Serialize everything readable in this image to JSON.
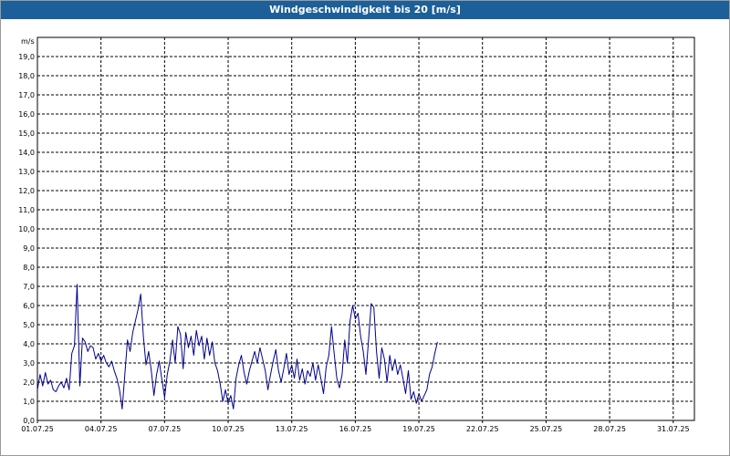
{
  "window": {
    "title": "Windgeschwindigkeit bis 20 [m/s]"
  },
  "colors": {
    "titlebar": "#1c5f99",
    "series": "#00008b",
    "grid": "#000000"
  },
  "chart_data": {
    "type": "line",
    "title": "Windgeschwindigkeit bis 20 [m/s]",
    "ylabel": "m/s",
    "xlabel": "",
    "ylim": [
      0,
      20
    ],
    "xlim": [
      "01.07.25",
      "01.08.25"
    ],
    "grid": true,
    "y_ticks": [
      "0,0",
      "1,0",
      "2,0",
      "3,0",
      "4,0",
      "5,0",
      "6,0",
      "7,0",
      "8,0",
      "9,0",
      "10,0",
      "11,0",
      "12,0",
      "13,0",
      "14,0",
      "15,0",
      "16,0",
      "17,0",
      "18,0",
      "19,0"
    ],
    "x_ticks": [
      "01.07.25",
      "04.07.25",
      "07.07.25",
      "10.07.25",
      "13.07.25",
      "16.07.25",
      "19.07.25",
      "22.07.25",
      "25.07.25",
      "28.07.25",
      "31.07.25"
    ],
    "series": [
      {
        "values": [
          {
            "x": "01.07.25 00:00",
            "y": 1.6
          },
          {
            "x": "01.07.25 03:00",
            "y": 2.4
          },
          {
            "x": "01.07.25 06:00",
            "y": 1.8
          },
          {
            "x": "01.07.25 09:00",
            "y": 2.5
          },
          {
            "x": "01.07.25 12:00",
            "y": 1.9
          },
          {
            "x": "01.07.25 15:00",
            "y": 2.1
          },
          {
            "x": "01.07.25 18:00",
            "y": 1.6
          },
          {
            "x": "01.07.25 21:00",
            "y": 1.5
          },
          {
            "x": "02.07.25 00:00",
            "y": 1.8
          },
          {
            "x": "02.07.25 03:00",
            "y": 2.0
          },
          {
            "x": "02.07.25 06:00",
            "y": 1.7
          },
          {
            "x": "02.07.25 09:00",
            "y": 2.2
          },
          {
            "x": "02.07.25 12:00",
            "y": 1.6
          },
          {
            "x": "02.07.25 15:00",
            "y": 3.5
          },
          {
            "x": "02.07.25 18:00",
            "y": 3.9
          },
          {
            "x": "02.07.25 21:00",
            "y": 7.1
          },
          {
            "x": "03.07.25 00:00",
            "y": 1.8
          },
          {
            "x": "03.07.25 03:00",
            "y": 4.3
          },
          {
            "x": "03.07.25 06:00",
            "y": 4.1
          },
          {
            "x": "03.07.25 09:00",
            "y": 3.6
          },
          {
            "x": "03.07.25 12:00",
            "y": 3.9
          },
          {
            "x": "03.07.25 15:00",
            "y": 3.8
          },
          {
            "x": "03.07.25 18:00",
            "y": 3.2
          },
          {
            "x": "03.07.25 21:00",
            "y": 3.5
          },
          {
            "x": "04.07.25 00:00",
            "y": 3.1
          },
          {
            "x": "04.07.25 03:00",
            "y": 3.4
          },
          {
            "x": "04.07.25 06:00",
            "y": 3.0
          },
          {
            "x": "04.07.25 09:00",
            "y": 2.8
          },
          {
            "x": "04.07.25 12:00",
            "y": 3.1
          },
          {
            "x": "04.07.25 15:00",
            "y": 2.6
          },
          {
            "x": "04.07.25 18:00",
            "y": 2.2
          },
          {
            "x": "04.07.25 21:00",
            "y": 1.6
          },
          {
            "x": "05.07.25 00:00",
            "y": 0.6
          },
          {
            "x": "05.07.25 03:00",
            "y": 2.4
          },
          {
            "x": "05.07.25 06:00",
            "y": 4.2
          },
          {
            "x": "05.07.25 09:00",
            "y": 3.6
          },
          {
            "x": "05.07.25 12:00",
            "y": 4.6
          },
          {
            "x": "05.07.25 15:00",
            "y": 5.2
          },
          {
            "x": "05.07.25 18:00",
            "y": 5.8
          },
          {
            "x": "05.07.25 21:00",
            "y": 6.6
          },
          {
            "x": "06.07.25 00:00",
            "y": 4.4
          },
          {
            "x": "06.07.25 03:00",
            "y": 2.9
          },
          {
            "x": "06.07.25 06:00",
            "y": 3.6
          },
          {
            "x": "06.07.25 09:00",
            "y": 2.6
          },
          {
            "x": "06.07.25 12:00",
            "y": 1.3
          },
          {
            "x": "06.07.25 15:00",
            "y": 2.4
          },
          {
            "x": "06.07.25 18:00",
            "y": 3.1
          },
          {
            "x": "06.07.25 21:00",
            "y": 2.1
          },
          {
            "x": "07.07.25 00:00",
            "y": 1.2
          },
          {
            "x": "07.07.25 03:00",
            "y": 2.4
          },
          {
            "x": "07.07.25 06:00",
            "y": 3.1
          },
          {
            "x": "07.07.25 09:00",
            "y": 4.2
          },
          {
            "x": "07.07.25 12:00",
            "y": 3.0
          },
          {
            "x": "07.07.25 15:00",
            "y": 4.9
          },
          {
            "x": "07.07.25 18:00",
            "y": 4.5
          },
          {
            "x": "07.07.25 21:00",
            "y": 2.7
          },
          {
            "x": "08.07.25 00:00",
            "y": 4.6
          },
          {
            "x": "08.07.25 03:00",
            "y": 3.8
          },
          {
            "x": "08.07.25 06:00",
            "y": 4.4
          },
          {
            "x": "08.07.25 09:00",
            "y": 3.4
          },
          {
            "x": "08.07.25 12:00",
            "y": 4.7
          },
          {
            "x": "08.07.25 15:00",
            "y": 3.9
          },
          {
            "x": "08.07.25 18:00",
            "y": 4.4
          },
          {
            "x": "08.07.25 21:00",
            "y": 3.2
          },
          {
            "x": "09.07.25 00:00",
            "y": 4.3
          },
          {
            "x": "09.07.25 03:00",
            "y": 3.4
          },
          {
            "x": "09.07.25 06:00",
            "y": 4.1
          },
          {
            "x": "09.07.25 09:00",
            "y": 3.0
          },
          {
            "x": "09.07.25 12:00",
            "y": 2.6
          },
          {
            "x": "09.07.25 15:00",
            "y": 1.9
          },
          {
            "x": "09.07.25 18:00",
            "y": 1.0
          },
          {
            "x": "09.07.25 21:00",
            "y": 1.6
          },
          {
            "x": "10.07.25 00:00",
            "y": 0.9
          },
          {
            "x": "10.07.25 03:00",
            "y": 1.3
          },
          {
            "x": "10.07.25 06:00",
            "y": 0.6
          },
          {
            "x": "10.07.25 09:00",
            "y": 2.2
          },
          {
            "x": "10.07.25 12:00",
            "y": 2.9
          },
          {
            "x": "10.07.25 15:00",
            "y": 3.4
          },
          {
            "x": "10.07.25 18:00",
            "y": 2.5
          },
          {
            "x": "10.07.25 21:00",
            "y": 1.9
          },
          {
            "x": "11.07.25 00:00",
            "y": 2.6
          },
          {
            "x": "11.07.25 03:00",
            "y": 3.1
          },
          {
            "x": "11.07.25 06:00",
            "y": 3.6
          },
          {
            "x": "11.07.25 09:00",
            "y": 3.0
          },
          {
            "x": "11.07.25 12:00",
            "y": 3.8
          },
          {
            "x": "11.07.25 15:00",
            "y": 3.2
          },
          {
            "x": "11.07.25 18:00",
            "y": 2.6
          },
          {
            "x": "11.07.25 21:00",
            "y": 1.6
          },
          {
            "x": "12.07.25 00:00",
            "y": 2.4
          },
          {
            "x": "12.07.25 03:00",
            "y": 3.1
          },
          {
            "x": "12.07.25 06:00",
            "y": 3.7
          },
          {
            "x": "12.07.25 09:00",
            "y": 2.6
          },
          {
            "x": "12.07.25 12:00",
            "y": 2.0
          },
          {
            "x": "12.07.25 15:00",
            "y": 2.7
          },
          {
            "x": "12.07.25 18:00",
            "y": 3.5
          },
          {
            "x": "12.07.25 21:00",
            "y": 2.4
          },
          {
            "x": "13.07.25 00:00",
            "y": 2.9
          },
          {
            "x": "13.07.25 03:00",
            "y": 2.2
          },
          {
            "x": "13.07.25 06:00",
            "y": 3.2
          },
          {
            "x": "13.07.25 09:00",
            "y": 2.1
          },
          {
            "x": "13.07.25 12:00",
            "y": 2.7
          },
          {
            "x": "13.07.25 15:00",
            "y": 1.9
          },
          {
            "x": "13.07.25 18:00",
            "y": 2.6
          },
          {
            "x": "13.07.25 21:00",
            "y": 2.3
          },
          {
            "x": "14.07.25 00:00",
            "y": 3.0
          },
          {
            "x": "14.07.25 03:00",
            "y": 2.1
          },
          {
            "x": "14.07.25 06:00",
            "y": 2.9
          },
          {
            "x": "14.07.25 09:00",
            "y": 2.2
          },
          {
            "x": "14.07.25 12:00",
            "y": 1.4
          },
          {
            "x": "14.07.25 15:00",
            "y": 2.8
          },
          {
            "x": "14.07.25 18:00",
            "y": 3.4
          },
          {
            "x": "14.07.25 21:00",
            "y": 4.9
          },
          {
            "x": "15.07.25 00:00",
            "y": 3.5
          },
          {
            "x": "15.07.25 03:00",
            "y": 2.2
          },
          {
            "x": "15.07.25 06:00",
            "y": 1.7
          },
          {
            "x": "15.07.25 09:00",
            "y": 2.4
          },
          {
            "x": "15.07.25 12:00",
            "y": 4.2
          },
          {
            "x": "15.07.25 15:00",
            "y": 3.0
          },
          {
            "x": "15.07.25 18:00",
            "y": 5.2
          },
          {
            "x": "15.07.25 21:00",
            "y": 6.0
          },
          {
            "x": "16.07.25 00:00",
            "y": 5.3
          },
          {
            "x": "16.07.25 03:00",
            "y": 5.6
          },
          {
            "x": "16.07.25 06:00",
            "y": 4.4
          },
          {
            "x": "16.07.25 09:00",
            "y": 3.6
          },
          {
            "x": "16.07.25 12:00",
            "y": 2.4
          },
          {
            "x": "16.07.25 15:00",
            "y": 4.2
          },
          {
            "x": "16.07.25 18:00",
            "y": 6.1
          },
          {
            "x": "16.07.25 21:00",
            "y": 5.9
          },
          {
            "x": "17.07.25 00:00",
            "y": 3.6
          },
          {
            "x": "17.07.25 03:00",
            "y": 2.2
          },
          {
            "x": "17.07.25 06:00",
            "y": 3.8
          },
          {
            "x": "17.07.25 09:00",
            "y": 3.2
          },
          {
            "x": "17.07.25 12:00",
            "y": 2.0
          },
          {
            "x": "17.07.25 15:00",
            "y": 3.4
          },
          {
            "x": "17.07.25 18:00",
            "y": 2.6
          },
          {
            "x": "17.07.25 21:00",
            "y": 3.2
          },
          {
            "x": "18.07.25 00:00",
            "y": 2.4
          },
          {
            "x": "18.07.25 03:00",
            "y": 2.9
          },
          {
            "x": "18.07.25 06:00",
            "y": 2.2
          },
          {
            "x": "18.07.25 09:00",
            "y": 1.4
          },
          {
            "x": "18.07.25 12:00",
            "y": 2.6
          },
          {
            "x": "18.07.25 15:00",
            "y": 1.1
          },
          {
            "x": "18.07.25 18:00",
            "y": 1.5
          },
          {
            "x": "18.07.25 21:00",
            "y": 0.9
          },
          {
            "x": "19.07.25 00:00",
            "y": 1.4
          },
          {
            "x": "19.07.25 03:00",
            "y": 1.0
          },
          {
            "x": "19.07.25 06:00",
            "y": 1.3
          },
          {
            "x": "19.07.25 09:00",
            "y": 1.6
          },
          {
            "x": "19.07.25 12:00",
            "y": 2.4
          },
          {
            "x": "19.07.25 15:00",
            "y": 2.8
          },
          {
            "x": "19.07.25 18:00",
            "y": 3.5
          },
          {
            "x": "19.07.25 21:00",
            "y": 4.1
          }
        ]
      }
    ]
  }
}
